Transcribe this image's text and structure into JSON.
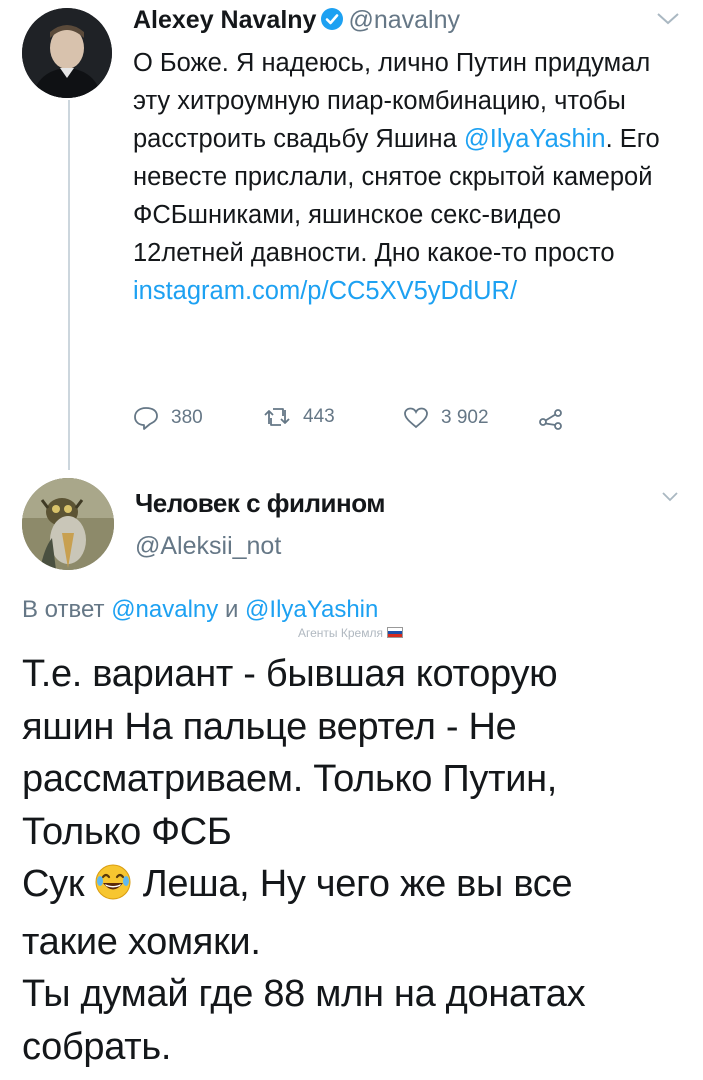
{
  "tweet1": {
    "author_name": "Alexey Navalny",
    "author_handle": "@navalny",
    "text_part1": "О Боже. Я надеюсь, лично Путин придумал эту хитроумную пиар-комбинацию, чтобы расстроить свадьбу Яшина ",
    "mention": "@IlyaYashin",
    "text_part2": ". Его невесте прислали, снятое скрытой камерой ФСБшниками, яшинское секс-видео 12летней давности. Дно какое-то просто ",
    "link": "instagram.com/p/CC5XV5yDdUR/",
    "replies": "380",
    "retweets": "443",
    "likes": "3 902"
  },
  "tweet2": {
    "author_name": "Человек с филином",
    "author_handle": "@Aleksii_not",
    "reply_prefix": "В ответ ",
    "reply_mention_1": "@navalny",
    "reply_and": " и ",
    "reply_mention_2": "@IlyaYashin",
    "watermark": "Агенты Кремля",
    "lines": [
      "Т.е. вариант - бывшая которую",
      "яшин На пальце вертел - Не",
      "рассматриваем. Только Путин,",
      "Только ФСБ",
      "Сук",
      " Леша, Ну чего же вы все",
      "такие хомяки.",
      "Ты думай где 88 млн на донатах",
      "собрать."
    ]
  },
  "icons": {
    "verified": "verified-badge-icon",
    "chevron": "chevron-down-icon",
    "reply": "reply-icon",
    "retweet": "retweet-icon",
    "like": "heart-icon",
    "share": "share-icon",
    "emoji": "laughing-tears-emoji"
  },
  "colors": {
    "link": "#1da1f2",
    "secondary_text": "#657786",
    "primary_text": "#14171a"
  }
}
